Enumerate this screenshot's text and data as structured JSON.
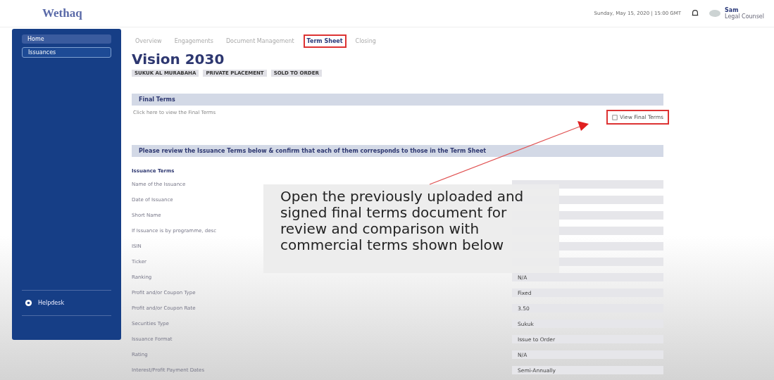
{
  "header": {
    "logo": "Wethaq",
    "datetime": "Sunday, May 15, 2020 | 15:00 GMT",
    "user": {
      "name": "Sam",
      "role": "Legal Counsel"
    }
  },
  "sidebar": {
    "items": [
      {
        "label": "Home",
        "selected": false
      },
      {
        "label": "Issuances",
        "selected": true
      }
    ],
    "footer_item": "Helpdesk"
  },
  "tabs": [
    {
      "label": "Overview",
      "selected": false,
      "highlighted": false
    },
    {
      "label": "Engagements",
      "selected": false,
      "highlighted": false
    },
    {
      "label": "Document Management",
      "selected": false,
      "highlighted": false
    },
    {
      "label": "Term Sheet",
      "selected": true,
      "highlighted": true
    },
    {
      "label": "Closing",
      "selected": false,
      "highlighted": false
    }
  ],
  "title": "Vision 2030",
  "tags": [
    "SUKUK AL MURABAHA",
    "PRIVATE PLACEMENT",
    "SOLD TO ORDER"
  ],
  "final_terms": {
    "heading": "Final Terms",
    "text": "Click here to view the Final Terms",
    "button": {
      "label": "View Final Terms",
      "highlighted": true
    }
  },
  "review": {
    "heading": "Please review the Issuance Terms below & confirm that each of them corresponds to those in the Term Sheet",
    "subheading": "Issuance Terms",
    "rows": [
      {
        "label": "Name of the Issuance"
      },
      {
        "label": "Date of Issuance"
      },
      {
        "label": "Short Name"
      },
      {
        "label": "If Issuance is by programme, desc"
      },
      {
        "label": "ISIN"
      },
      {
        "label": "Ticker"
      },
      {
        "label": "Ranking",
        "value": "N/A"
      },
      {
        "label": "Profit and/or Coupon Type",
        "value": "Fixed"
      },
      {
        "label": "Profit and/or Coupon Rate",
        "value": "3.50"
      },
      {
        "label": "Securities Type",
        "value": "Sukuk"
      },
      {
        "label": "Issuance Format",
        "value": "Issue to Order"
      },
      {
        "label": "Rating",
        "value": "N/A"
      },
      {
        "label": "Interest/Profit Payment Dates",
        "value": "Semi-Annually"
      }
    ]
  },
  "callout": {
    "text": "Open the previously uploaded and signed final terms document for review and comparison with commercial terms shown below"
  }
}
